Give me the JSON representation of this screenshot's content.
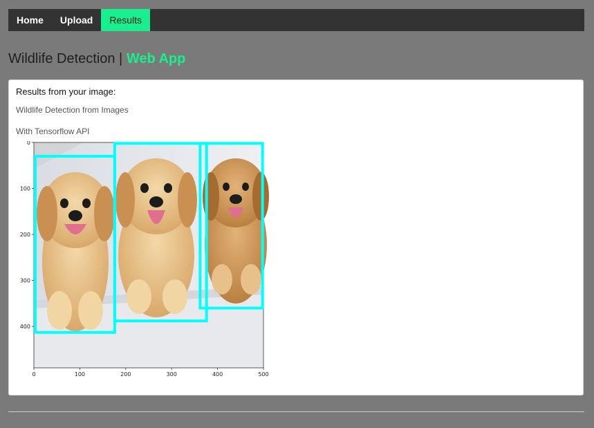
{
  "nav": {
    "items": [
      {
        "label": "Home",
        "active": false
      },
      {
        "label": "Upload",
        "active": false
      },
      {
        "label": "Results",
        "active": true
      }
    ],
    "background": "#333333",
    "accent": "#18f08f"
  },
  "page": {
    "title_main": "Wildlife Detection | ",
    "title_accent": "Web App"
  },
  "card": {
    "heading": "Results from your image:",
    "subtitle": "Wildlife Detection from Images",
    "api_line": "With Tensorflow API"
  },
  "chart_data": {
    "type": "scatter",
    "description_kind": "image-plot",
    "x_ticks": [
      0,
      100,
      200,
      300,
      400,
      500
    ],
    "y_ticks": [
      0,
      100,
      200,
      300,
      400
    ],
    "xlim": [
      0,
      500
    ],
    "ylim": [
      0,
      490
    ],
    "y_inverted": true,
    "grid": false,
    "box_color": "#00ffff",
    "boxes": [
      {
        "x0": 3,
        "y0": 30,
        "x1": 176,
        "y1": 413,
        "label": ""
      },
      {
        "x0": 176,
        "y0": 2,
        "x1": 376,
        "y1": 388,
        "label": ""
      },
      {
        "x0": 362,
        "y0": 2,
        "x1": 498,
        "y1": 360,
        "label": ""
      }
    ]
  }
}
